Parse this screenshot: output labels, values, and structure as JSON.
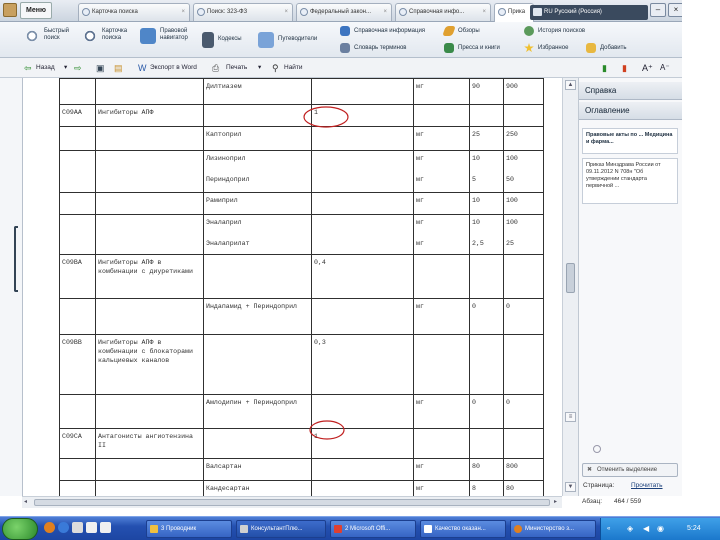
{
  "window": {
    "menu_label": "Меню",
    "tabs": [
      {
        "label": "Карточка поиска"
      },
      {
        "label": "Поиск: 323-ФЗ"
      },
      {
        "label": "Федеральный закон..."
      },
      {
        "label": "Справочная инфо..."
      },
      {
        "label": "Прика"
      }
    ],
    "language_label": "RU Русский (Россия)"
  },
  "toolbar": {
    "quick_search": "Быстрый\nпоиск",
    "card_search": "Карточка\nпоиска",
    "legal_navigator": "Правовой\nнавигатор",
    "codes": "Кодексы",
    "guide": "Путеводители",
    "reference_info": "Справочная информация",
    "review": "Обзоры",
    "search_history": "История поисков",
    "dictionary": "Словарь терминов",
    "press_books": "Пресса и книги",
    "favorites": "Избранное",
    "add": "Добавить"
  },
  "navbar": {
    "back": "Назад",
    "export_word": "Экспорт в Word",
    "print": "Печать",
    "find": "Найти"
  },
  "table": {
    "rows": [
      {
        "code": "",
        "group": "",
        "drug": "Дилтиазем",
        "dose": "",
        "unit": "мг",
        "ddd": "90",
        "ckd": "900"
      },
      {
        "code": "C09AA",
        "group": "Ингибиторы АПФ",
        "drug": "",
        "dose": "1",
        "unit": "",
        "ddd": "",
        "ckd": ""
      },
      {
        "code": "",
        "group": "",
        "drug": "Каптоприл",
        "dose": "",
        "unit": "мг",
        "ddd": "25",
        "ckd": "250"
      },
      {
        "code": "",
        "group": "",
        "drug": "Лизиноприл",
        "dose": "",
        "unit": "мг",
        "ddd": "10",
        "ckd": "100",
        "drug2": "Периндоприл",
        "unit2": "мг",
        "ddd2": "5",
        "ckd2": "50"
      },
      {
        "code": "",
        "group": "",
        "drug": "Рамиприл",
        "dose": "",
        "unit": "мг",
        "ddd": "10",
        "ckd": "100"
      },
      {
        "code": "",
        "group": "",
        "drug": "Эналаприл",
        "dose": "",
        "unit": "мг",
        "ddd": "10",
        "ckd": "100",
        "drug2": "Эналаприлат",
        "unit2": "мг",
        "ddd2": "2,5",
        "ckd2": "25"
      },
      {
        "code": "C09BA",
        "group": "Ингибиторы АПФ в комбинации с диуретиками",
        "drug": "",
        "dose": "0,4",
        "unit": "",
        "ddd": "",
        "ckd": ""
      },
      {
        "code": "",
        "group": "",
        "drug": "Индапамид + Периндоприл",
        "dose": "",
        "unit": "мг",
        "ddd": "0",
        "ckd": "0"
      },
      {
        "code": "C09BB",
        "group": "Ингибиторы АПФ в комбинации с блокаторами кальциевых каналов",
        "drug": "",
        "dose": "0,3",
        "unit": "",
        "ddd": "",
        "ckd": ""
      },
      {
        "code": "",
        "group": "",
        "drug": "Амлодипин + Периндоприл",
        "dose": "",
        "unit": "мг",
        "ddd": "0",
        "ckd": "0"
      },
      {
        "code": "C09CA",
        "group": "Антагонисты ангиотензина II",
        "drug": "",
        "dose": "1",
        "unit": "",
        "ddd": "",
        "ckd": ""
      },
      {
        "code": "",
        "group": "",
        "drug": "Валсартан",
        "dose": "",
        "unit": "мг",
        "ddd": "80",
        "ckd": "800"
      },
      {
        "code": "",
        "group": "",
        "drug": "Кандесартан",
        "dose": "",
        "unit": "мг",
        "ddd": "8",
        "ckd": "80"
      }
    ]
  },
  "right_panel": {
    "help": "Справка",
    "contents": "Оглавление",
    "card1": "Правовые акты по ... Медицина и фарма...",
    "card2": "Приказ Минздрава России от 09.11.2012 N 708н \"Об утверждении стандарта первичной ...",
    "clear_marks": "Отменить выделение",
    "page_label": "Страница:",
    "page_link": "Прочитать",
    "paragraph_label": "Абзац:",
    "paragraph_value": "464 / 559"
  },
  "taskbar": {
    "items": [
      {
        "label": "3 Проводник"
      },
      {
        "label": "КонсультантПлю..."
      },
      {
        "label": "2 Microsoft Offi..."
      },
      {
        "label": "Качество оказан..."
      },
      {
        "label": "Министерство з..."
      }
    ],
    "clock": "5:24"
  }
}
